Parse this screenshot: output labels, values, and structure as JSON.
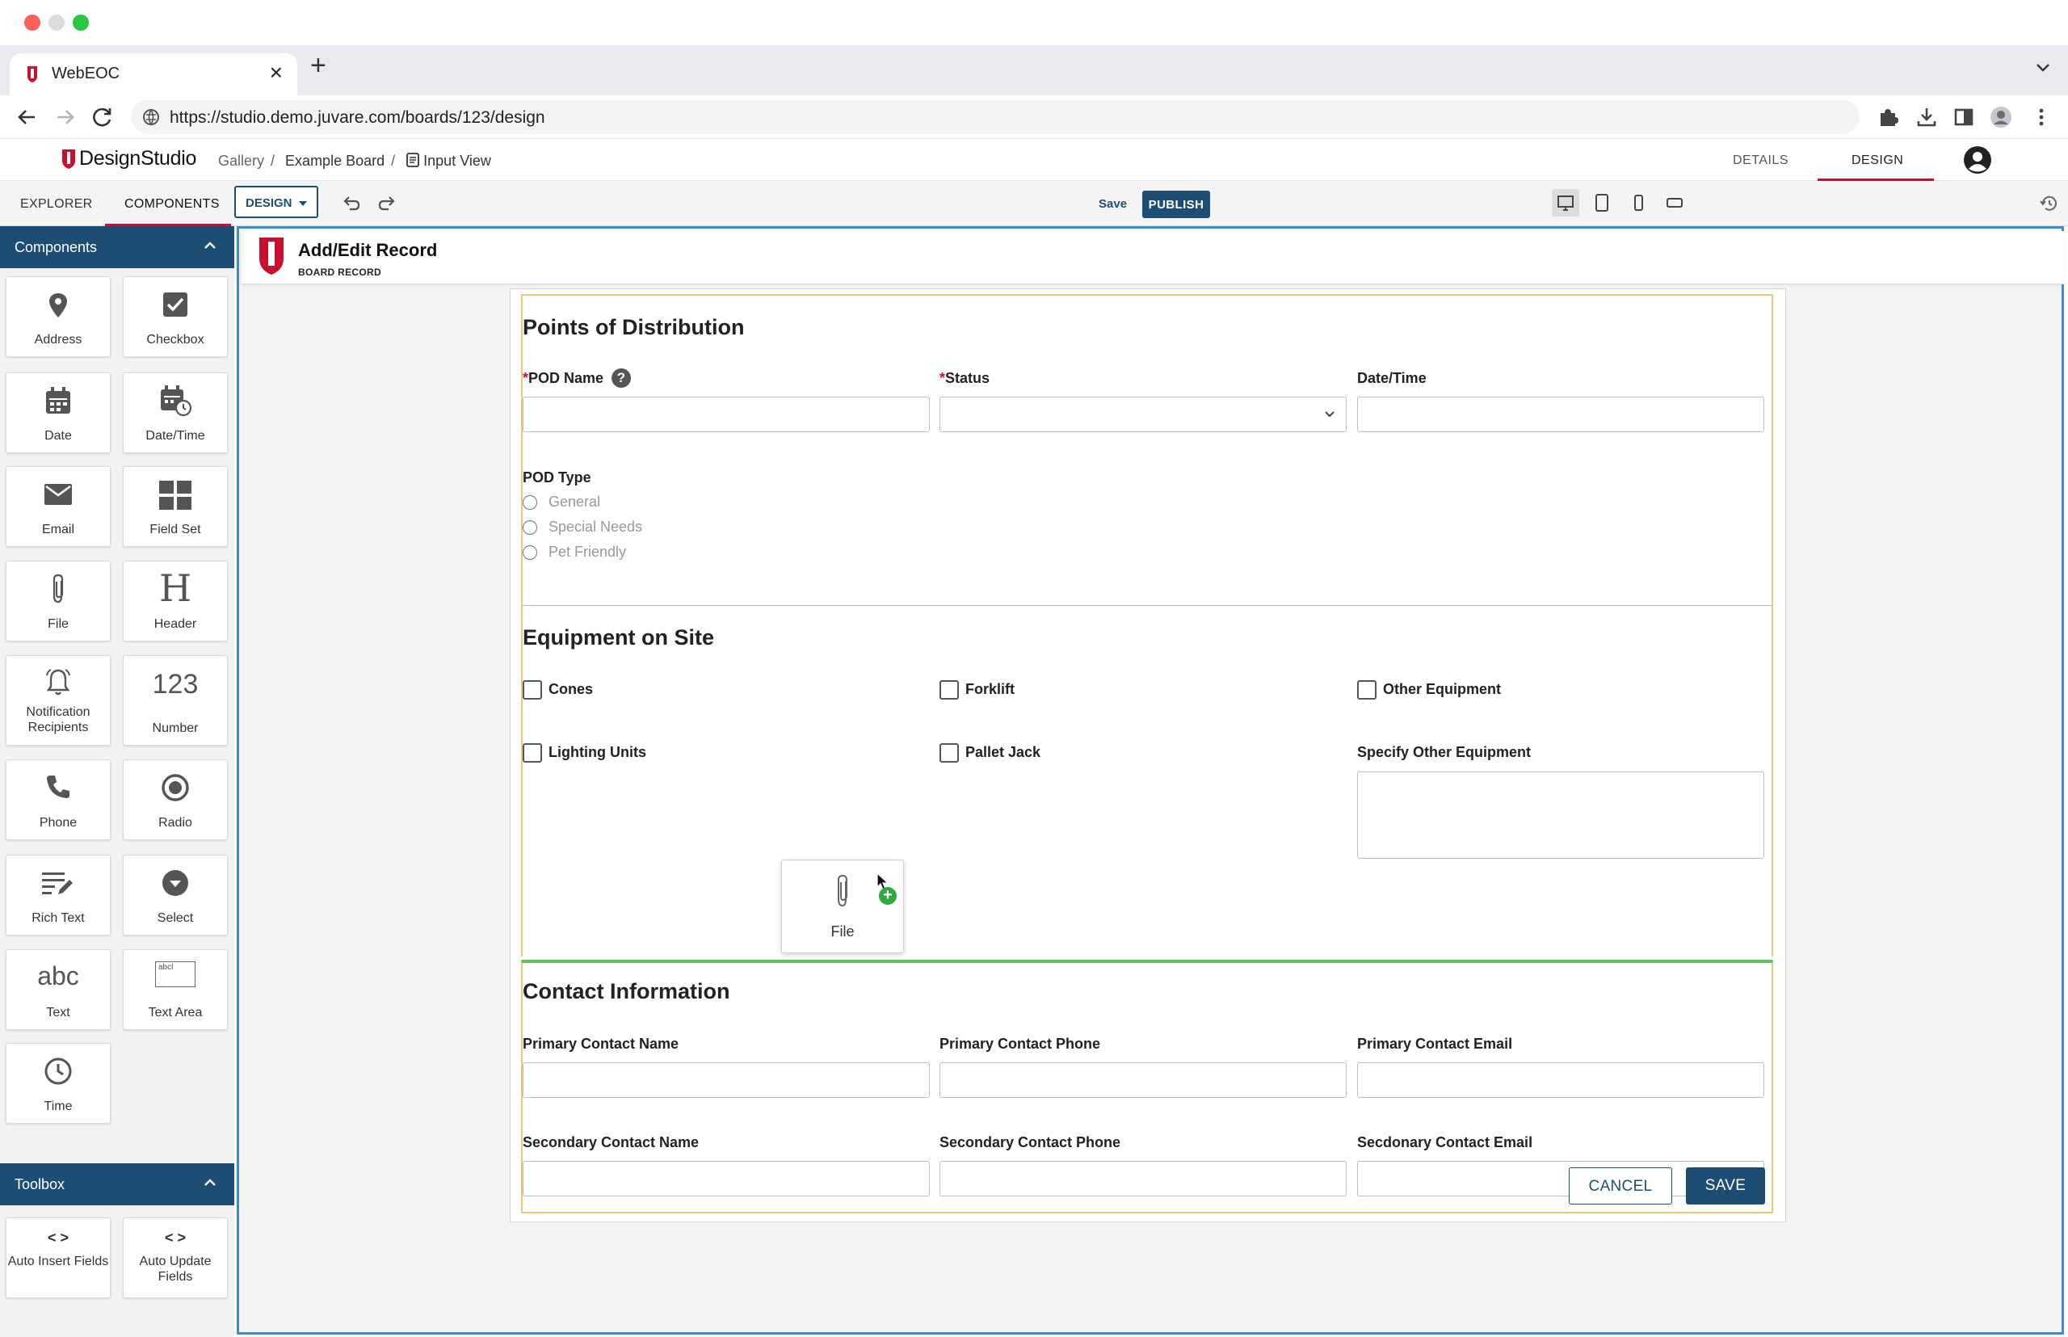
{
  "browser": {
    "tab_title": "WebEOC",
    "url": "https://studio.demo.juvare.com/boards/123/design"
  },
  "app": {
    "logo_text": "DesignStudio",
    "breadcrumbs": [
      "Gallery",
      "Example Board",
      "Input View"
    ],
    "top_nav": [
      "DETAILS",
      "DESIGN"
    ],
    "active_top_nav": "DESIGN",
    "accent": "#c8102e",
    "primary": "#1e4d73"
  },
  "subbar": {
    "tabs": [
      "EXPLORER",
      "COMPONENTS"
    ],
    "active_tab": "COMPONENTS",
    "mode_dropdown": "DESIGN",
    "save_label": "Save",
    "publish_label": "PUBLISH",
    "devices": [
      "desktop-icon",
      "tablet-icon",
      "phone-icon",
      "landscape-phone-icon"
    ],
    "active_device": "desktop-icon"
  },
  "sidebar": {
    "components_title": "Components",
    "components": [
      {
        "label": "Address",
        "icon": "map-pin-icon"
      },
      {
        "label": "Checkbox",
        "icon": "checkbox-icon"
      },
      {
        "label": "Date",
        "icon": "calendar-icon"
      },
      {
        "label": "Date/Time",
        "icon": "calendar-clock-icon"
      },
      {
        "label": "Email",
        "icon": "envelope-icon"
      },
      {
        "label": "Field Set",
        "icon": "grid-icon"
      },
      {
        "label": "File",
        "icon": "paperclip-icon"
      },
      {
        "label": "Header",
        "icon": "header-icon"
      },
      {
        "label": "Notification Recipients",
        "icon": "bell-icon"
      },
      {
        "label": "Number",
        "icon": "number-icon",
        "glyph": "123"
      },
      {
        "label": "Phone",
        "icon": "phone-icon"
      },
      {
        "label": "Radio",
        "icon": "radio-icon"
      },
      {
        "label": "Rich Text",
        "icon": "rich-text-icon"
      },
      {
        "label": "Select",
        "icon": "select-icon"
      },
      {
        "label": "Text",
        "icon": "text-icon",
        "glyph": "abc"
      },
      {
        "label": "Text Area",
        "icon": "text-area-icon",
        "glyph": "abcl"
      },
      {
        "label": "Time",
        "icon": "clock-icon"
      }
    ],
    "toolbox_title": "Toolbox",
    "toolbox": [
      {
        "label": "Auto Insert Fields",
        "icon": "code-icon"
      },
      {
        "label": "Auto Update Fields",
        "icon": "code-icon"
      }
    ]
  },
  "record": {
    "title": "Add/Edit Record",
    "subtitle": "BOARD RECORD"
  },
  "form": {
    "pod": {
      "title": "Points of Distribution",
      "pod_name_label": "POD Name",
      "status_label": "Status",
      "datetime_label": "Date/Time",
      "pod_type_label": "POD Type",
      "pod_type_options": [
        "General",
        "Special Needs",
        "Pet Friendly"
      ],
      "required_mark": "*",
      "help_glyph": "?"
    },
    "equipment": {
      "title": "Equipment on Site",
      "checkboxes": [
        "Cones",
        "Forklift",
        "Other Equipment",
        "Lighting Units",
        "Pallet Jack"
      ],
      "specify_label": "Specify Other Equipment"
    },
    "contact": {
      "title": "Contact Information",
      "fields": [
        "Primary Contact Name",
        "Primary Contact Phone",
        "Primary Contact Email",
        "Secondary Contact Name",
        "Secondary Contact Phone",
        "Secdonary Contact Email"
      ]
    },
    "drag_item": {
      "label": "File",
      "icon": "paperclip-icon",
      "badge": "+"
    },
    "buttons": {
      "cancel": "CANCEL",
      "save": "SAVE"
    }
  }
}
